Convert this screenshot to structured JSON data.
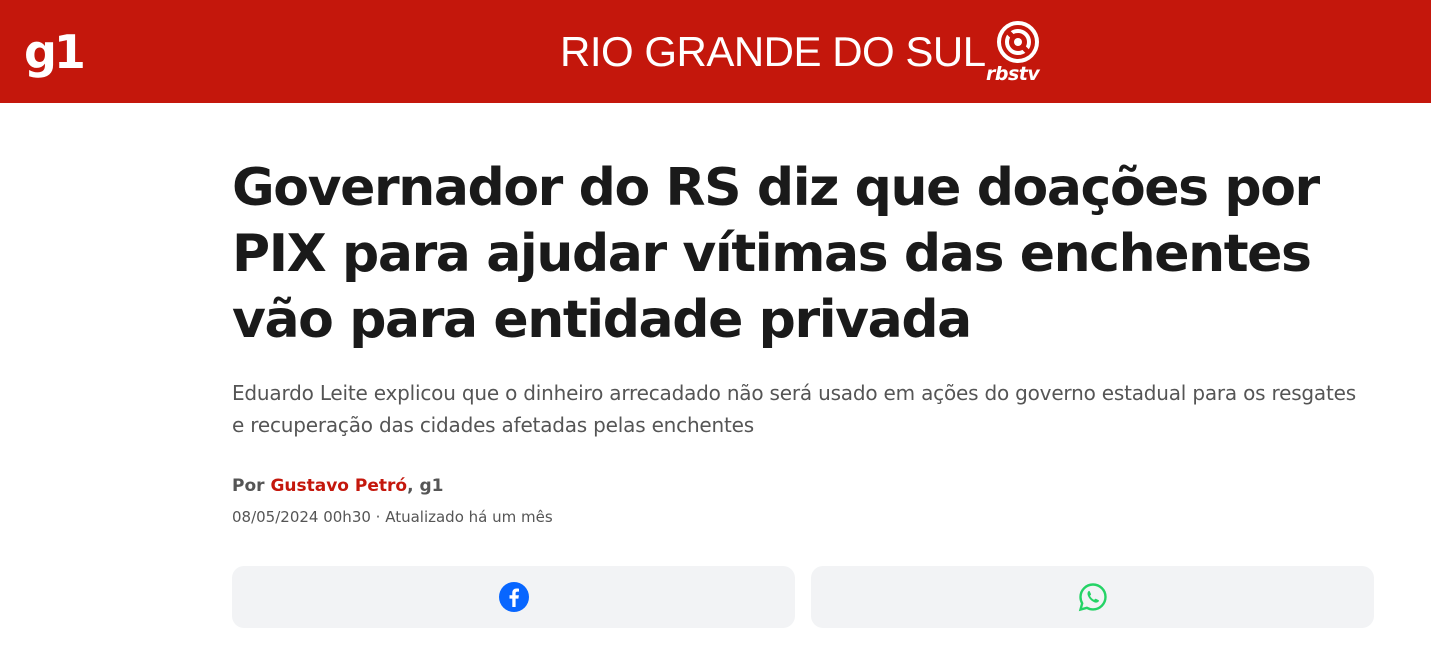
{
  "header": {
    "logo": "g1",
    "section": "RIO GRANDE DO SUL",
    "partner_logo_text": "rbstv",
    "background": "#c4170c"
  },
  "article": {
    "title": "Governador do RS diz que doações por PIX para ajudar vítimas das enchentes vão para entidade privada",
    "subtitle": "Eduardo Leite explicou que o dinheiro arrecadado não será usado em ações do governo estadual para os resgates e recuperação das cidades afetadas pelas enchentes",
    "byline_prefix": "Por",
    "author": "Gustavo Petró",
    "byline_suffix": ", g1",
    "date": "08/05/2024 00h30 · Atualizado há um mês"
  },
  "share": {
    "facebook_icon": "facebook-icon",
    "whatsapp_icon": "whatsapp-icon",
    "facebook_color": "#0866ff",
    "whatsapp_color": "#25d366"
  }
}
